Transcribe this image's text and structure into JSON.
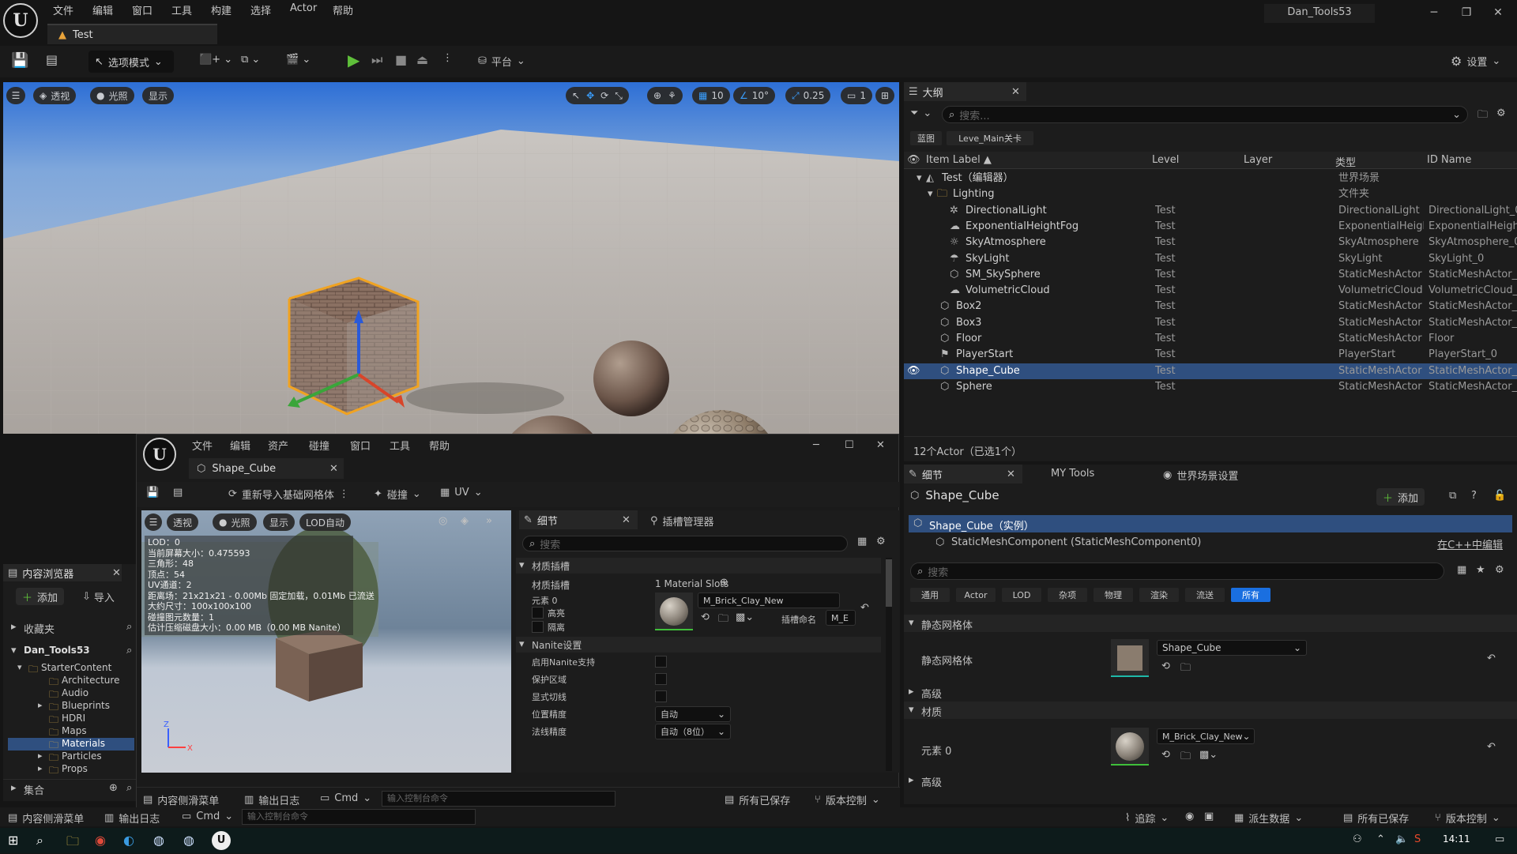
{
  "menu": [
    "文件",
    "编辑",
    "窗口",
    "工具",
    "构建",
    "选择",
    "Actor",
    "帮助"
  ],
  "project_name": "Dan_Tools53",
  "level_tab": "Test",
  "toolbar": {
    "mode": "选项模式",
    "platform": "平台",
    "settings": "设置"
  },
  "viewport": {
    "perspective": "透视",
    "lighting": "光照",
    "show": "显示",
    "grid": "10",
    "angle": "10°",
    "scale": "0.25",
    "camera_speed": "1"
  },
  "outliner": {
    "title": "大纲",
    "search_placeholder": "搜索...",
    "crumb_blueprint": "蓝图",
    "crumb_level": "Leve_Main关卡",
    "columns": [
      "Item Label ▲",
      "Level",
      "Layer",
      "类型",
      "ID Name"
    ],
    "rows": [
      {
        "label": "Test（编辑器）",
        "level": "",
        "type": "世界场景",
        "id": ""
      },
      {
        "label": "Lighting",
        "level": "",
        "type": "文件夹",
        "id": ""
      },
      {
        "label": "DirectionalLight",
        "level": "Test",
        "type": "DirectionalLight",
        "id": "DirectionalLight_0"
      },
      {
        "label": "ExponentialHeightFog",
        "level": "Test",
        "type": "ExponentialHeightF",
        "id": "ExponentialHeightF"
      },
      {
        "label": "SkyAtmosphere",
        "level": "Test",
        "type": "SkyAtmosphere",
        "id": "SkyAtmosphere_0"
      },
      {
        "label": "SkyLight",
        "level": "Test",
        "type": "SkyLight",
        "id": "SkyLight_0"
      },
      {
        "label": "SM_SkySphere",
        "level": "Test",
        "type": "StaticMeshActor",
        "id": "StaticMeshActor_1"
      },
      {
        "label": "VolumetricCloud",
        "level": "Test",
        "type": "VolumetricCloud",
        "id": "VolumetricCloud_0"
      },
      {
        "label": "Box2",
        "level": "Test",
        "type": "StaticMeshActor",
        "id": "StaticMeshActor_1"
      },
      {
        "label": "Box3",
        "level": "Test",
        "type": "StaticMeshActor",
        "id": "StaticMeshActor_1"
      },
      {
        "label": "Floor",
        "level": "Test",
        "type": "StaticMeshActor",
        "id": "Floor"
      },
      {
        "label": "PlayerStart",
        "level": "Test",
        "type": "PlayerStart",
        "id": "PlayerStart_0"
      },
      {
        "label": "Shape_Cube",
        "level": "Test",
        "type": "StaticMeshActor",
        "id": "StaticMeshActor_2"
      },
      {
        "label": "Sphere",
        "level": "Test",
        "type": "StaticMeshActor",
        "id": "StaticMeshActor_1"
      }
    ],
    "footer": "12个Actor（已选1个）"
  },
  "details": {
    "tab_details": "细节",
    "tab_mytools": "MY Tools",
    "tab_world": "世界场景设置",
    "actor_name": "Shape_Cube",
    "add": "添加",
    "instance": "Shape_Cube（实例）",
    "component": "StaticMeshComponent (StaticMeshComponent0)",
    "edit_cpp": "在C++中编辑",
    "search_placeholder": "搜索",
    "filters": [
      "通用",
      "Actor",
      "LOD",
      "杂项",
      "物理",
      "渲染",
      "流送",
      "所有"
    ],
    "sec_static_mesh": "静态网格体",
    "static_mesh_label": "静态网格体",
    "static_mesh_value": "Shape_Cube",
    "advanced": "高级",
    "sec_materials": "材质",
    "element0": "元素 0",
    "material_value": "M_Brick_Clay_New",
    "advanced2": "高级"
  },
  "content_browser": {
    "title": "内容浏览器",
    "add": "添加",
    "import": "导入",
    "favorites": "收藏夹",
    "root": "Dan_Tools53",
    "folders": [
      "StarterContent",
      "Architecture",
      "Audio",
      "Blueprints",
      "HDRI",
      "Maps",
      "Materials",
      "Particles",
      "Props"
    ],
    "collections": "集合"
  },
  "sme": {
    "menu": [
      "文件",
      "编辑",
      "资产",
      "碰撞",
      "窗口",
      "工具",
      "帮助"
    ],
    "tab": "Shape_Cube",
    "reimport": "重新导入基础网格体",
    "collision": "碰撞",
    "uv": "UV",
    "vp": {
      "perspective": "透视",
      "lighting": "光照",
      "show": "显示",
      "lod": "LOD自动"
    },
    "stats": [
      "LOD：0",
      "当前屏幕大小：0.475593",
      "三角形：48",
      "顶点：54",
      "UV通道：2",
      "距离场：21x21x21 - 0.00Mb 固定加载，0.01Mb 已流送",
      "大约尺寸：100x100x100",
      "碰撞图元数量：1",
      "估计压缩磁盘大小：0.00 MB（0.00 MB Nanite）"
    ],
    "details_tab": "细节",
    "socket_tab": "插槽管理器",
    "search_placeholder": "搜索",
    "sec_material_slots": "材质插槽",
    "material_slots_label": "材质插槽",
    "material_slots_value": "1 Material Slots",
    "element0": "元素 0",
    "highlight": "高亮",
    "isolate": "隔离",
    "material_name": "M_Brick_Clay_New",
    "slot_name_label": "插槽命名",
    "slot_name_value": "M_E",
    "sec_nanite": "Nanite设置",
    "nanite_rows": [
      "启用Nanite支持",
      "保护区域",
      "显式切线",
      "位置精度",
      "法线精度"
    ],
    "position_precision": "自动",
    "normal_precision": "自动（8位）",
    "bottom": {
      "drawer": "内容侧滑菜单",
      "log": "输出日志",
      "cmd": "Cmd",
      "console_placeholder": "输入控制台命令",
      "saved": "所有已保存",
      "vc": "版本控制"
    }
  },
  "statusbar": {
    "drawer": "内容侧滑菜单",
    "log": "输出日志",
    "cmd": "Cmd",
    "console_placeholder": "输入控制台命令",
    "trace": "追踪",
    "derived": "派生数据",
    "saved": "所有已保存",
    "vc": "版本控制"
  },
  "taskbar": {
    "time": "14:11"
  }
}
